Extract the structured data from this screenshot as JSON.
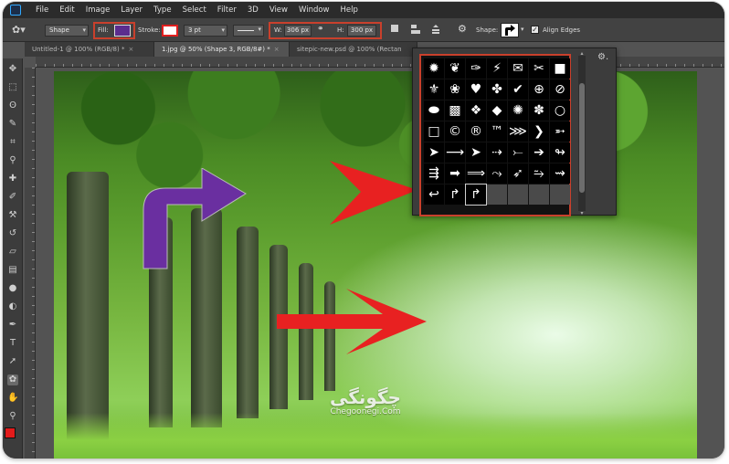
{
  "menu": [
    "File",
    "Edit",
    "Image",
    "Layer",
    "Type",
    "Select",
    "Filter",
    "3D",
    "View",
    "Window",
    "Help"
  ],
  "options": {
    "mode": "Shape",
    "fill_label": "Fill:",
    "stroke_label": "Stroke:",
    "stroke_size": "3 pt",
    "w_label": "W:",
    "w_value": "306 px",
    "h_label": "H:",
    "h_value": "300 px",
    "shape_label": "Shape:",
    "align_label": "Align Edges",
    "align_checked": true,
    "fill_color": "#5b2d8e",
    "stroke_color": "#e01f1f",
    "highlight_color": "#c9402c"
  },
  "tabs": [
    {
      "label": "Untitled-1 @ 100% (RGB/8) *",
      "close": "×"
    },
    {
      "label": "1.jpg @ 50% (Shape 3, RGB/8#) *",
      "close": "×"
    },
    {
      "label": "sitepic-new.psd @ 100% (Rectan",
      "close": ""
    }
  ],
  "toolbar": {
    "icons": [
      "move-icon",
      "marquee-icon",
      "lasso-icon",
      "quick-select-icon",
      "crop-icon",
      "eyedropper-icon",
      "healing-icon",
      "brush-icon",
      "clone-stamp-icon",
      "history-brush-icon",
      "eraser-icon",
      "gradient-icon",
      "blur-icon",
      "dodge-icon",
      "pen-icon",
      "type-icon",
      "path-select-icon",
      "custom-shape-icon",
      "hand-icon",
      "zoom-icon"
    ],
    "foreground": "#e31b1b",
    "background": "#ffffff"
  },
  "canvas": {
    "shape_color": "#6a2fa0",
    "arrow_color": "#e82121"
  },
  "watermark": {
    "brand": "چگونگی",
    "url": "Chegoonegi.Com"
  },
  "shapes": [
    "✹",
    "❦",
    "✑",
    "⚡",
    "✉",
    "✂",
    "■",
    "⚜",
    "❀",
    "♥",
    "✤",
    "✔",
    "⊕",
    "⊘",
    "⬬",
    "▩",
    "❖",
    "◆",
    "✺",
    "✽",
    "○",
    "□",
    "©",
    "®",
    "™",
    "⋙",
    "❯",
    "➵",
    "➤",
    "⟶",
    "➤",
    "⇢",
    "⤚",
    "➔",
    "↬",
    "⇶",
    "➡",
    "⟹",
    "⤳",
    "➶",
    "⥲",
    "⇝",
    "↩",
    "↱",
    "↱"
  ]
}
